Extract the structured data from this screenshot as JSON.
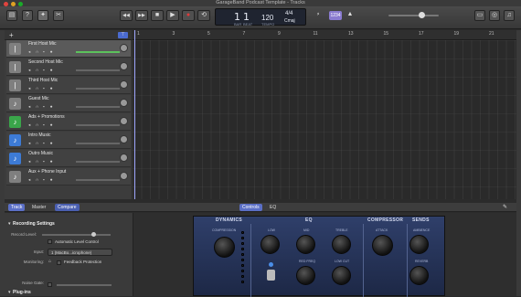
{
  "window": {
    "title": "GarageBand Podcast Template - Tracks"
  },
  "toolbar": {
    "library_icon": "library-icon",
    "help_icon": "help-icon",
    "smart_controls_icon": "smart-controls-icon",
    "editors_icon": "scissors-icon",
    "transport": {
      "rewind": "◀◀",
      "forward": "▶▶",
      "stop": "■",
      "play": "▶",
      "record": "●",
      "cycle": "⟲"
    },
    "lcd": {
      "bar": "1",
      "beat": "1",
      "bar_label": "BAR",
      "beat_label": "BEAT",
      "tempo": "120",
      "tempo_label": "TEMPO",
      "signature": "4/4",
      "key": "Cmaj"
    },
    "tuner_icon": "tuner-icon",
    "count_in": "1234",
    "metronome_icon": "metronome-icon",
    "right_icons": [
      "notepad-icon",
      "loops-icon",
      "media-icon"
    ]
  },
  "tracklist": {
    "add_label": "+",
    "filter_label": "⊤",
    "tracks": [
      {
        "name": "First Host Mic",
        "icon": "mic-icon",
        "color": "#7f7f7f"
      },
      {
        "name": "Second Host Mic",
        "icon": "mic-icon",
        "color": "#7f7f7f"
      },
      {
        "name": "Third Host Mic",
        "icon": "mic-icon",
        "color": "#7f7f7f"
      },
      {
        "name": "Guest Mic",
        "icon": "person-icon",
        "color": "#7f7f7f"
      },
      {
        "name": "Ads + Promotions",
        "icon": "music-note-icon",
        "color": "#3aa64a"
      },
      {
        "name": "Intro Music",
        "icon": "waveform-icon",
        "color": "#3d7bd6"
      },
      {
        "name": "Outro Music",
        "icon": "waveform-icon",
        "color": "#3d7bd6"
      },
      {
        "name": "Aux + Phone Input",
        "icon": "guitar-icon",
        "color": "#7f7f7f"
      }
    ]
  },
  "ruler": {
    "numbers": [
      "1",
      "3",
      "5",
      "7",
      "9",
      "11",
      "13",
      "15",
      "17",
      "19",
      "21"
    ]
  },
  "editor": {
    "tabs": [
      "Track",
      "Master",
      "Compare"
    ],
    "center_tabs": [
      "Controls",
      "EQ"
    ],
    "recording_settings": "Recording Settings",
    "record_level_label": "Record Level:",
    "auto_level": "Automatic Level Control",
    "input_label": "Input:",
    "input_value": "1 (MacBo...icrophone)",
    "monitoring_label": "Monitoring:",
    "feedback": "Feedback Protection",
    "noise_gate_label": "Noise Gate:",
    "plugins": "Plug-ins"
  },
  "strip": {
    "sections": [
      "DYNAMICS",
      "EQ",
      "COMPRESSOR",
      "SENDS"
    ],
    "labels": [
      "COMPRESSION",
      "LOW",
      "MID",
      "TREBLE",
      "RED FREQ",
      "LOW CUT",
      "ATTACK",
      "AMBIENCE",
      "REVERB"
    ]
  }
}
